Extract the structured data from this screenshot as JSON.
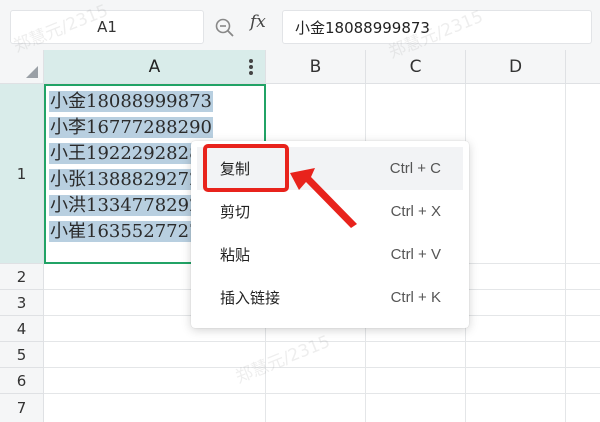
{
  "formula_bar": {
    "name_box": "A1",
    "fx_label": "fx",
    "formula_value": "小金18088999873"
  },
  "columns": [
    "A",
    "B",
    "C",
    "D"
  ],
  "rows": [
    "1",
    "2",
    "3",
    "4",
    "5",
    "6",
    "7"
  ],
  "cell_a1_lines": [
    "小金18088999873",
    "小李16777288290",
    "小王19222928282",
    "小张13888292727",
    "小洪13347782929",
    "小崔16355277272"
  ],
  "context_menu": [
    {
      "label": "复制",
      "shortcut": "Ctrl + C"
    },
    {
      "label": "剪切",
      "shortcut": "Ctrl + X"
    },
    {
      "label": "粘贴",
      "shortcut": "Ctrl + V"
    },
    {
      "label": "插入链接",
      "shortcut": "Ctrl + K"
    }
  ],
  "watermark": "郑慧元/2315",
  "colors": {
    "selection_border": "#21a366",
    "header_selected": "#d9ecea",
    "annotation_red": "#e8231c",
    "text_highlight": "#b8cfe0"
  }
}
